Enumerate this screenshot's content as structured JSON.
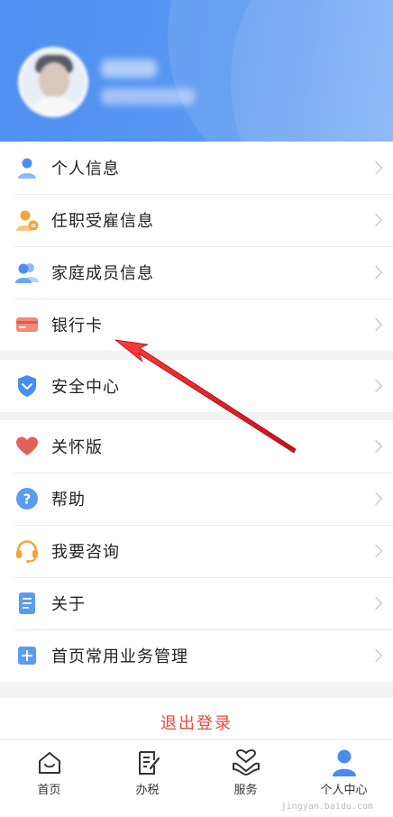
{
  "menu_group1": [
    {
      "label": "个人信息",
      "icon": "person-icon"
    },
    {
      "label": "任职受雇信息",
      "icon": "employment-icon"
    },
    {
      "label": "家庭成员信息",
      "icon": "family-icon"
    },
    {
      "label": "银行卡",
      "icon": "bank-card-icon"
    }
  ],
  "menu_group2": [
    {
      "label": "安全中心",
      "icon": "shield-icon"
    }
  ],
  "menu_group3": [
    {
      "label": "关怀版",
      "icon": "heart-icon"
    },
    {
      "label": "帮助",
      "icon": "help-icon"
    },
    {
      "label": "我要咨询",
      "icon": "headset-icon"
    },
    {
      "label": "关于",
      "icon": "document-icon"
    },
    {
      "label": "首页常用业务管理",
      "icon": "plus-square-icon"
    }
  ],
  "logout_label": "退出登录",
  "tabs": [
    {
      "label": "首页",
      "icon": "home-icon"
    },
    {
      "label": "办税",
      "icon": "tax-icon"
    },
    {
      "label": "服务",
      "icon": "service-icon"
    },
    {
      "label": "个人中心",
      "icon": "user-center-icon"
    }
  ],
  "watermark": "jingyan.baidu.com",
  "colors": {
    "header": "#4f8ff0",
    "accent_blue": "#4a8cf0",
    "logout_red": "#e8473f",
    "arrow_red": "#e8202a"
  }
}
